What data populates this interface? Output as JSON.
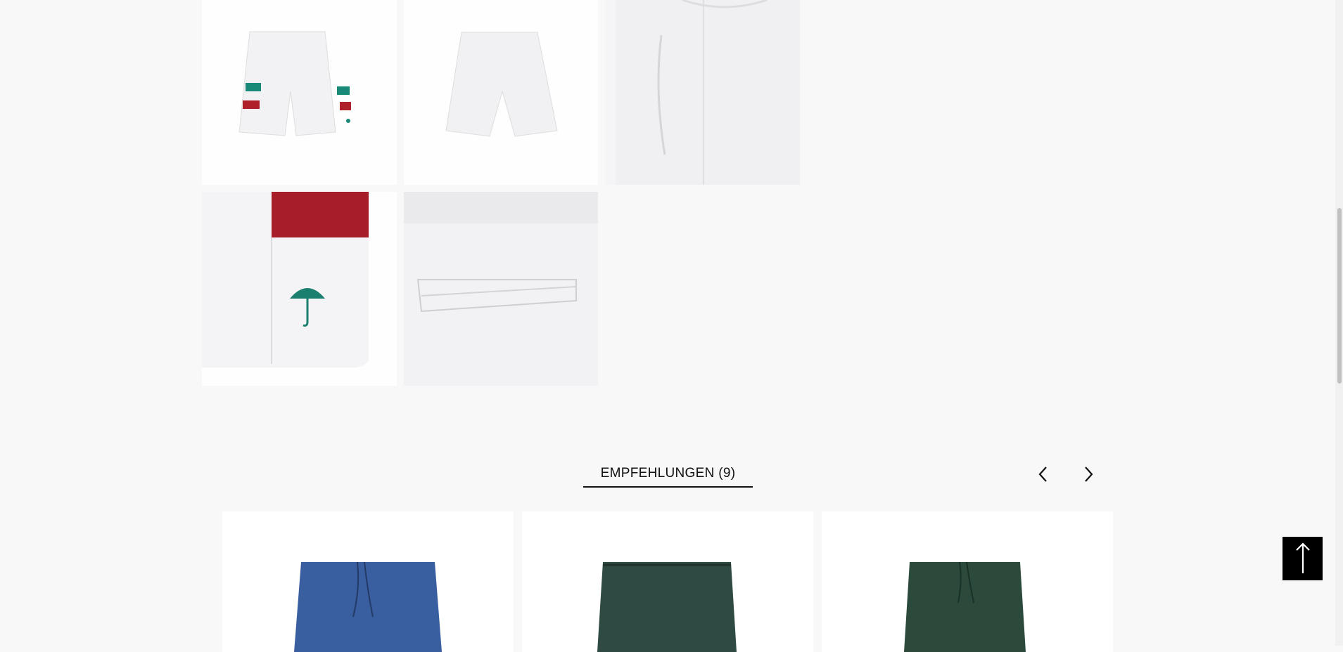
{
  "gallery": {
    "images": [
      {
        "alt": "white-shorts-front"
      },
      {
        "alt": "white-shorts-back"
      },
      {
        "alt": "white-shorts-side-detail"
      },
      {
        "alt": "umbrella-logo-detail"
      },
      {
        "alt": "back-pocket-detail"
      }
    ]
  },
  "recommendations": {
    "title": "EMPFEHLUNGEN (9)",
    "prev_icon": "chevron-left-icon",
    "next_icon": "chevron-right-icon",
    "products": [
      {
        "color": "#3a5fa0",
        "image": "blue-shorts"
      },
      {
        "color": "#2f4a42",
        "image": "dark-green-shorts"
      },
      {
        "color": "#2b4a3c",
        "image": "green-shorts"
      }
    ]
  },
  "back_to_top": {
    "icon": "arrow-up-icon"
  }
}
